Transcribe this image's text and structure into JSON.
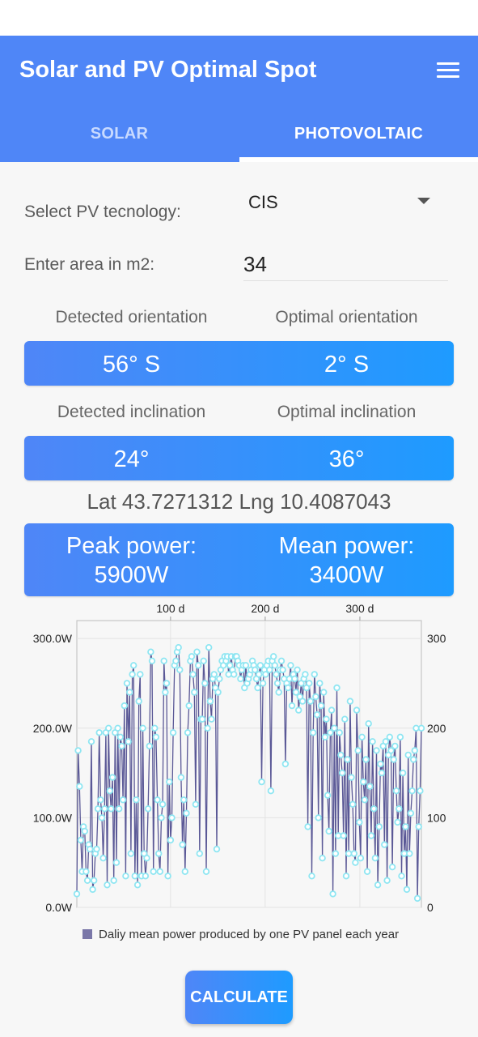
{
  "app": {
    "title": "Solar and PV Optimal Spot"
  },
  "tabs": [
    {
      "label": "SOLAR"
    },
    {
      "label": "PHOTOVOLTAIC"
    }
  ],
  "form": {
    "tech_label": "Select PV tecnology:",
    "tech_value": "CIS",
    "area_label": "Enter area in m2:",
    "area_value": "34"
  },
  "orientation": {
    "detected_label": "Detected orientation",
    "optimal_label": "Optimal orientation",
    "detected_value": "56° S",
    "optimal_value": "2° S"
  },
  "inclination": {
    "detected_label": "Detected inclination",
    "optimal_label": "Optimal inclination",
    "detected_value": "24°",
    "optimal_value": "36°"
  },
  "location": {
    "text": "Lat 43.7271312 Lng 10.4087043"
  },
  "power": {
    "peak_label": "Peak power:",
    "peak_value": "5900W",
    "mean_label": "Mean power:",
    "mean_value": "3400W"
  },
  "calculate_label": "CALCULATE",
  "colors": {
    "accent": "#4f86f7",
    "accent2": "#1e9bff",
    "series_line": "#5a5896",
    "series_point": "#8fe6f2"
  },
  "chart_data": {
    "type": "line",
    "legend_label": "Daliy mean power produced by one PV panel each year",
    "x_axis_top": {
      "ticks": [
        "100 d",
        "200 d",
        "300 d"
      ],
      "tick_values": [
        100,
        200,
        300
      ],
      "range": [
        1,
        365
      ]
    },
    "y_left": {
      "ticks": [
        "300.0W",
        "200.0W",
        "100.0W",
        "0.0W"
      ],
      "tick_values": [
        300,
        200,
        100,
        0
      ],
      "range": [
        0,
        320
      ]
    },
    "y_right": {
      "ticks": [
        "300",
        "200",
        "100",
        "0"
      ]
    },
    "grid": true,
    "legend_position": "bottom",
    "series": [
      {
        "values": [
          15,
          175,
          135,
          75,
          40,
          90,
          85,
          40,
          30,
          70,
          65,
          185,
          20,
          30,
          60,
          65,
          110,
          195,
          120,
          100,
          55,
          110,
          195,
          25,
          200,
          130,
          110,
          145,
          30,
          195,
          50,
          200,
          110,
          190,
          180,
          120,
          225,
          35,
          250,
          185,
          240,
          60,
          260,
          270,
          35,
          120,
          25,
          230,
          260,
          35,
          200,
          60,
          35,
          55,
          110,
          180,
          285,
          275,
          40,
          200,
          190,
          120,
          60,
          40,
          100,
          115,
          275,
          240,
          250,
          35,
          140,
          75,
          100,
          195,
          270,
          275,
          285,
          290,
          265,
          145,
          70,
          120,
          40,
          105,
          195,
          225,
          275,
          280,
          260,
          240,
          115,
          285,
          270,
          60,
          210,
          210,
          275,
          250,
          40,
          200,
          290,
          230,
          210,
          255,
          260,
          245,
          65,
          240,
          255,
          265,
          275,
          270,
          280,
          275,
          280,
          260,
          270,
          280,
          265,
          260,
          280,
          280,
          275,
          270,
          255,
          265,
          270,
          245,
          270,
          250,
          255,
          260,
          265,
          275,
          270,
          265,
          255,
          245,
          260,
          270,
          140,
          250,
          265,
          260,
          270,
          275,
          265,
          130,
          275,
          280,
          270,
          260,
          250,
          240,
          265,
          275,
          265,
          255,
          160,
          250,
          245,
          255,
          270,
          225,
          260,
          255,
          240,
          265,
          220,
          235,
          250,
          230,
          255,
          260,
          245,
          90,
          250,
          230,
          35,
          195,
          260,
          235,
          215,
          100,
          250,
          225,
          55,
          240,
          190,
          210,
          125,
          85,
          195,
          220,
          15,
          200,
          60,
          245,
          80,
          195,
          170,
          150,
          80,
          210,
          35,
          165,
          60,
          230,
          145,
          115,
          60,
          50,
          220,
          175,
          95,
          55,
          190,
          140,
          120,
          165,
          40,
          205,
          135,
          80,
          185,
          110,
          55,
          175,
          25,
          90,
          160,
          150,
          180,
          70,
          185,
          30,
          170,
          190,
          175,
          45,
          165,
          180,
          130,
          95,
          110,
          190,
          35,
          150,
          60,
          90,
          20,
          170,
          60,
          105,
          130,
          165,
          175,
          200,
          10,
          90,
          130,
          200
        ]
      }
    ]
  }
}
